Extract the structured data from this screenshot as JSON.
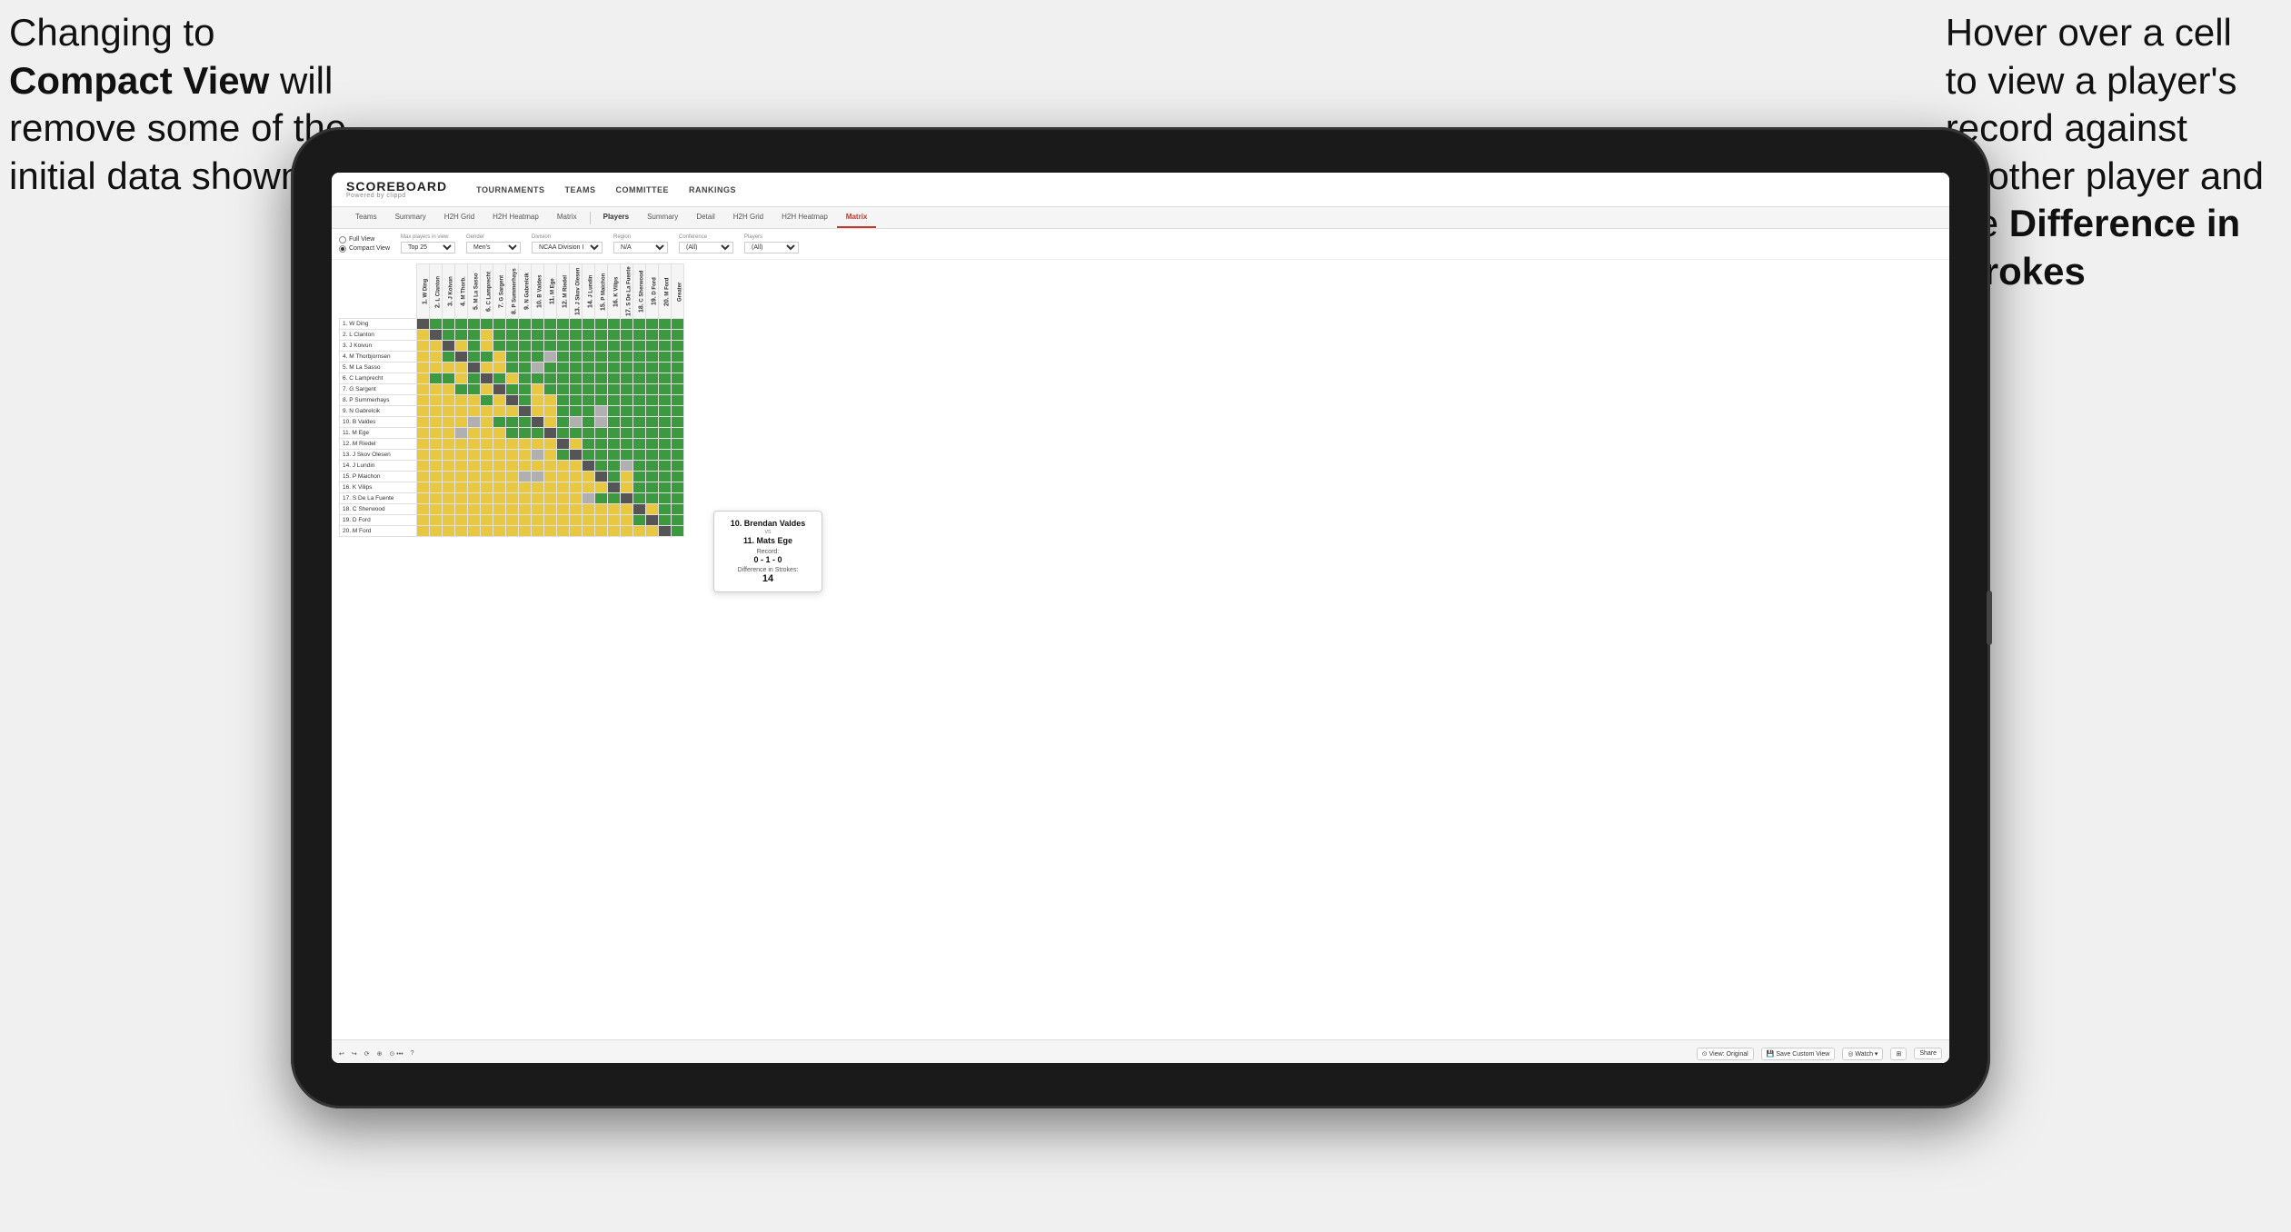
{
  "annotation_left": {
    "line1": "Changing to",
    "bold": "Compact View",
    "line2": " will",
    "line3": "remove some of the",
    "line4": "initial data shown"
  },
  "annotation_right": {
    "line1": "Hover over a cell",
    "line2": "to view a player's",
    "line3": "record against",
    "line4": "another player and",
    "line5_pre": "the ",
    "line5_bold": "Difference in",
    "line6_bold": "Strokes"
  },
  "nav": {
    "logo": "SCOREBOARD",
    "logo_sub": "Powered by clippd",
    "items": [
      "TOURNAMENTS",
      "TEAMS",
      "COMMITTEE",
      "RANKINGS"
    ]
  },
  "sub_nav": {
    "group1": [
      "Teams",
      "Summary",
      "H2H Grid",
      "H2H Heatmap",
      "Matrix"
    ],
    "group2_label": "Players",
    "group2": [
      "Summary",
      "Detail",
      "H2H Grid",
      "H2H Heatmap",
      "Matrix"
    ]
  },
  "controls": {
    "view_options": [
      "Full View",
      "Compact View"
    ],
    "selected_view": "Compact View",
    "max_players_label": "Max players in view",
    "max_players_value": "Top 25",
    "gender_label": "Gender",
    "gender_value": "Men's",
    "division_label": "Division",
    "division_value": "NCAA Division I",
    "region_label": "Region",
    "region_value": "N/A",
    "conference_label": "Conference",
    "conference_value": "(All)",
    "players_label": "Players",
    "players_value": "(All)"
  },
  "players": [
    "1. W Ding",
    "2. L Clanton",
    "3. J Koivun",
    "4. M Thorbjornsen",
    "5. M La Sasso",
    "6. C Lamprecht",
    "7. G Sargent",
    "8. P Summerhays",
    "9. N Gabrelcik",
    "10. B Valdes",
    "11. M Ege",
    "12. M Riedel",
    "13. J Skov Olesen",
    "14. J Lundin",
    "15. P Maichon",
    "16. K Vilips",
    "17. S De La Fuente",
    "18. C Sherwood",
    "19. D Ford",
    "20. M Ford"
  ],
  "col_headers": [
    "1. W Ding",
    "2. L Clanton",
    "3. J Koivun",
    "4. M Thorbjornsen",
    "5. M La Sasso",
    "6. C Lamprecht",
    "7. G Sargent",
    "8. P Summerhays",
    "9. N Gabrelcik",
    "10. B Valdes",
    "11. M Ege",
    "12. M Riedel",
    "13. J Skov Olesen",
    "14. J Lundin",
    "15. P Maichon",
    "16. K Vilips",
    "17. S De La Fuente",
    "18. C Sherwood",
    "19. D Ford",
    "20. M Ford",
    "Greater"
  ],
  "tooltip": {
    "player1": "10. Brendan Valdes",
    "vs": "vs",
    "player2": "11. Mats Ege",
    "record_label": "Record:",
    "record": "0 - 1 - 0",
    "diff_label": "Difference in Strokes:",
    "diff": "14"
  },
  "toolbar": {
    "undo": "↩",
    "redo": "↪",
    "view_original": "⊙ View: Original",
    "save_custom": "💾 Save Custom View",
    "watch": "◎ Watch ▾",
    "share": "Share"
  }
}
